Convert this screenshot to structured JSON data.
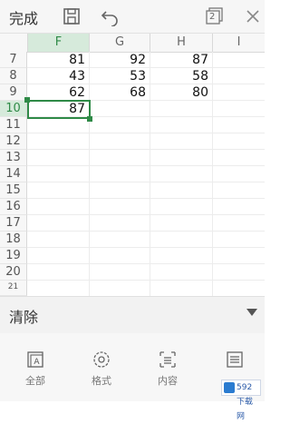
{
  "toolbar": {
    "done_label": "完成",
    "icons": [
      "save-icon",
      "undo-icon",
      "sheet-count-icon",
      "close-icon"
    ],
    "sheet_count": "2"
  },
  "grid": {
    "columns": [
      "F",
      "G",
      "H",
      "I"
    ],
    "selected_column": "F",
    "rows": [
      "7",
      "8",
      "9",
      "10",
      "11",
      "12",
      "13",
      "14",
      "15",
      "16",
      "17",
      "18",
      "19",
      "20",
      "21"
    ],
    "selected_row": "10",
    "cells": [
      [
        "81",
        "92",
        "87"
      ],
      [
        "43",
        "53",
        "58"
      ],
      [
        "62",
        "68",
        "80"
      ],
      [
        "87",
        "",
        ""
      ]
    ],
    "accent": "#2f8a47"
  },
  "clear_bar": {
    "label": "清除",
    "icon": "dropdown-triangle-icon"
  },
  "bottom_bar": {
    "items": [
      {
        "label": "全部",
        "icon": "all-icon"
      },
      {
        "label": "格式",
        "icon": "format-icon"
      },
      {
        "label": "内容",
        "icon": "content-icon"
      },
      {
        "label": "",
        "icon": "more-icon"
      }
    ]
  },
  "watermark": {
    "text": "592下载网"
  }
}
